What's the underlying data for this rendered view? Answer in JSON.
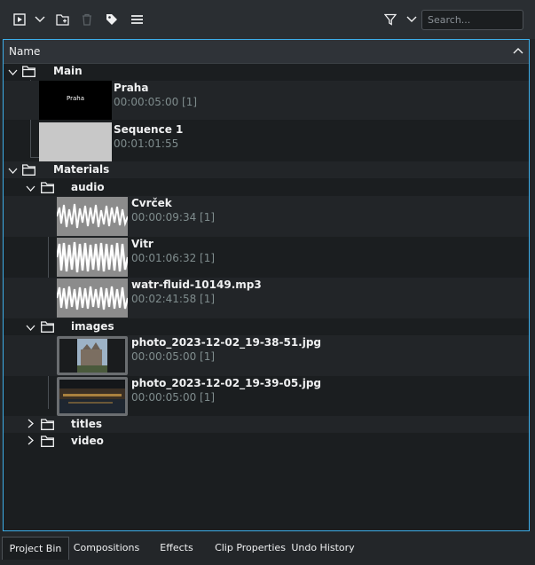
{
  "toolbar": {
    "icons": [
      "add-clip-icon",
      "chevron-down-icon",
      "add-folder-icon",
      "trash-icon",
      "tag-icon",
      "menu-icon",
      "filter-icon",
      "chevron-down-icon"
    ],
    "search_placeholder": "Search..."
  },
  "tree": {
    "column_header": "Name",
    "folders": {
      "main": "Main",
      "materials": "Materials",
      "audio": "audio",
      "images": "images",
      "titles": "titles",
      "video": "video"
    },
    "clips": [
      {
        "title": "Praha",
        "meta": "00:00:05:00 [1]",
        "thumb_text": "Praha"
      },
      {
        "title": "Sequence 1",
        "meta": "00:01:01:55"
      },
      {
        "title": "Cvrček",
        "meta": "00:00:09:34 [1]"
      },
      {
        "title": "Vitr",
        "meta": "00:01:06:32 [1]"
      },
      {
        "title": "watr-fluid-10149.mp3",
        "meta": "00:02:41:58 [1]"
      },
      {
        "title": "photo_2023-12-02_19-38-51.jpg",
        "meta": "00:00:05:00 [1]"
      },
      {
        "title": "photo_2023-12-02_19-39-05.jpg",
        "meta": "00:00:05:00 [1]"
      }
    ]
  },
  "tabs": [
    "Project Bin",
    "Compositions",
    "Effects",
    "Clip Properties",
    "Undo History"
  ],
  "colors": {
    "accent": "#3daee9",
    "background": "#1b1e20",
    "text": "#eff0f1",
    "muted": "#7f8c8d"
  }
}
